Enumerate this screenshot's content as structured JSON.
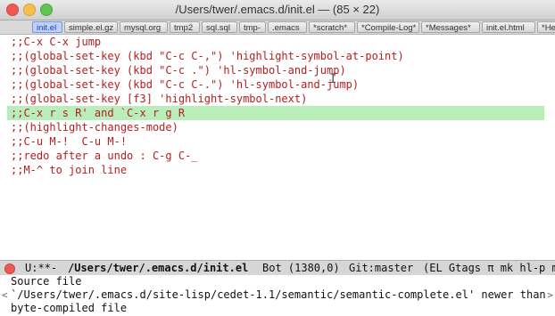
{
  "window": {
    "title": "/Users/twer/.emacs.d/init.el  —  (85 × 22)"
  },
  "tabs": [
    {
      "label": "init.el",
      "active": true
    },
    {
      "label": "simple.el.gz"
    },
    {
      "label": "mysql.org"
    },
    {
      "label": "tmp2"
    },
    {
      "label": "sql.sql"
    },
    {
      "label": "tmp-"
    },
    {
      "label": ".emacs"
    },
    {
      "label": "*scratch*"
    },
    {
      "label": "*Compile-Log*"
    },
    {
      "label": "*Messages*"
    },
    {
      "label": "init.el.html"
    },
    {
      "label": "*He"
    }
  ],
  "editor": {
    "lines": [
      ";;C-x C-x jump",
      ";;(global-set-key (kbd \"C-c C-,\") 'highlight-symbol-at-point)",
      ";;(global-set-key (kbd \"C-c .\") 'hl-symbol-and-jump)",
      ";;(global-set-key (kbd \"C-c C-.\") 'hl-symbol-and-jump)",
      ";;(global-set-key [f3] 'highlight-symbol-next)",
      ";;C-x r s R' and `C-x r g R",
      ";;(highlight-changes-mode)",
      ";;C-u M-!  C-u M-!",
      ";;redo after a undo : C-g C-_",
      ";;M-^ to join line"
    ],
    "highlighted_line_index": 5,
    "colors": {
      "comment": "#b22020",
      "highlight": "#b9eebb"
    }
  },
  "modeline": {
    "status": "U:**-",
    "file": "/Users/twer/.emacs.d/init.el",
    "position": "Bot (1380,0)",
    "vcs": "Git:master",
    "modes": "(EL Gtags π mk hl-p m"
  },
  "minibuffer": {
    "line1": "Source file",
    "line2": "`/Users/twer/.emacs.d/site-lisp/cedet-1.1/semantic/semantic-complete.el' newer than",
    "line3": "byte-compiled file"
  }
}
